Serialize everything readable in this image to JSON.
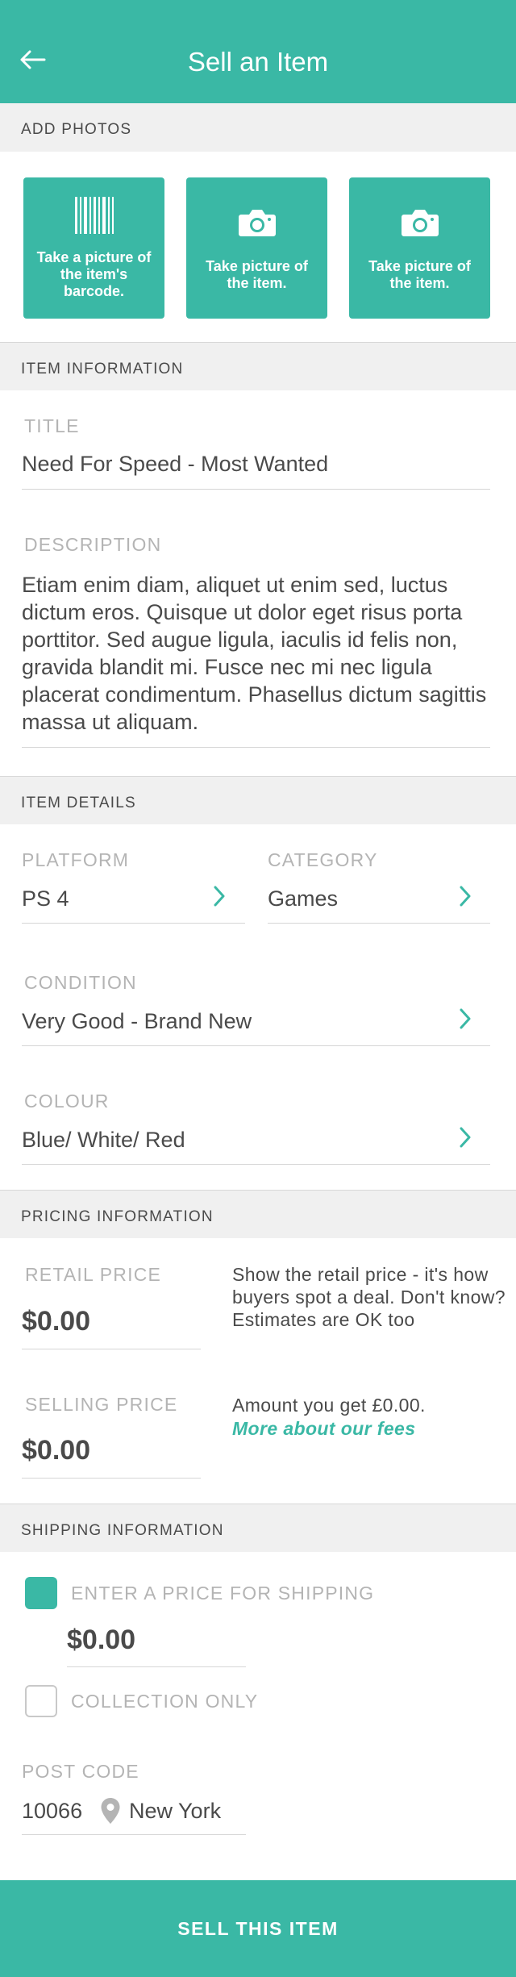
{
  "header": {
    "title": "Sell an Item",
    "back_icon": "arrow-left-icon"
  },
  "photos": {
    "section_title": "ADD PHOTOS",
    "tiles": [
      {
        "label": "Take a picture of the item's barcode.",
        "icon": "barcode-icon"
      },
      {
        "label": "Take picture of the item.",
        "icon": "camera-icon"
      },
      {
        "label": "Take picture of the item.",
        "icon": "camera-icon"
      }
    ]
  },
  "item_information": {
    "section_title": "ITEM INFORMATION",
    "title_label": "TITLE",
    "title_value": "Need For Speed - Most Wanted",
    "description_label": "DESCRIPTION",
    "description_value": "Etiam enim diam, aliquet ut enim sed, luctus dictum eros. Quisque ut dolor eget risus porta porttitor. Sed augue ligula, iaculis id felis non, gravida blandit mi. Fusce nec mi nec ligula placerat condimentum. Phasellus dictum sagittis massa ut aliquam."
  },
  "item_details": {
    "section_title": "ITEM DETAILS",
    "platform_label": "PLATFORM",
    "platform_value": "PS 4",
    "category_label": "CATEGORY",
    "category_value": "Games",
    "condition_label": "CONDITION",
    "condition_value": "Very Good - Brand New",
    "colour_label": "COLOUR",
    "colour_value": "Blue/ White/ Red"
  },
  "pricing": {
    "section_title": "PRICING INFORMATION",
    "retail_label": "RETAIL PRICE",
    "retail_value": "$0.00",
    "retail_note": "Show the retail price - it's how buyers spot a deal. Don't know? Estimates are OK too",
    "selling_label": "SELLING PRICE",
    "selling_value": "$0.00",
    "selling_note": "Amount you get £0.00.",
    "fees_link": "More about our fees"
  },
  "shipping": {
    "section_title": "SHIPPING INFORMATION",
    "shipping_price_label": "ENTER A PRICE FOR SHIPPING",
    "shipping_price_checked": true,
    "shipping_price_value": "$0.00",
    "collection_label": "COLLECTION ONLY",
    "collection_checked": false,
    "postcode_label": "POST CODE",
    "postcode_value": "10066",
    "city_value": "New York",
    "location_icon": "map-pin-icon"
  },
  "cta": {
    "label": "SELL THIS ITEM"
  },
  "colors": {
    "accent": "#3ab8a5",
    "section_bg": "#f0f0f0",
    "label_grey": "#b4b4b4",
    "text": "#4a4a4a"
  }
}
